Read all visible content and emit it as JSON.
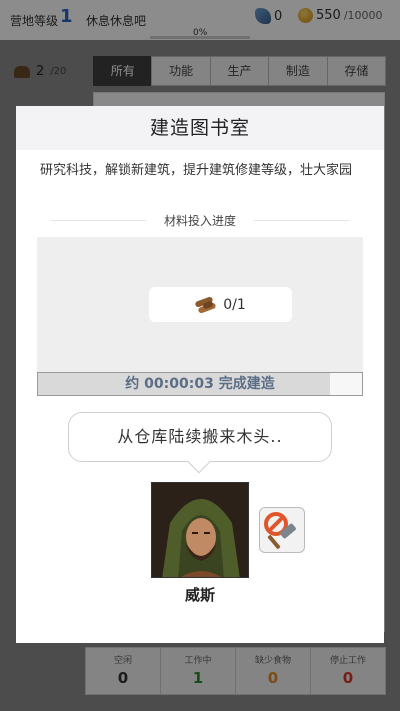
{
  "topbar": {
    "camp_level_label": "营地等级",
    "camp_level": "1",
    "status": "休息休息吧",
    "progress_percent": "0%",
    "gems": "0",
    "coins": "550",
    "coins_max": "/10000"
  },
  "population": {
    "current": "2",
    "max": "/20"
  },
  "tabs": [
    {
      "label": "所有",
      "active": true
    },
    {
      "label": "功能"
    },
    {
      "label": "生产"
    },
    {
      "label": "制造"
    },
    {
      "label": "存储"
    }
  ],
  "bottom_stats": [
    {
      "label": "空闲",
      "value": "0",
      "color": "#333333"
    },
    {
      "label": "工作中",
      "value": "1",
      "color": "#2e8b2e"
    },
    {
      "label": "缺少食物",
      "value": "0",
      "color": "#e08a2a"
    },
    {
      "label": "停止工作",
      "value": "0",
      "color": "#d83a2a"
    }
  ],
  "modal": {
    "title": "建造图书室",
    "description": "研究科技，解锁新建筑，提升建筑修建等级，壮大家园",
    "materials_label": "材料投入进度",
    "material": {
      "icon": "wood-logs-icon",
      "progress": "0/1"
    },
    "timer_text": "约 00:00:03 完成建造",
    "timer_fill_fraction": 0.9,
    "speech": "从仓库陆续搬来木头..",
    "worker_name": "威斯"
  },
  "colors": {
    "accent_blue": "#2a63c8",
    "timer_text": "#5b6e86",
    "tab_active_bg": "#3e3e3e"
  }
}
